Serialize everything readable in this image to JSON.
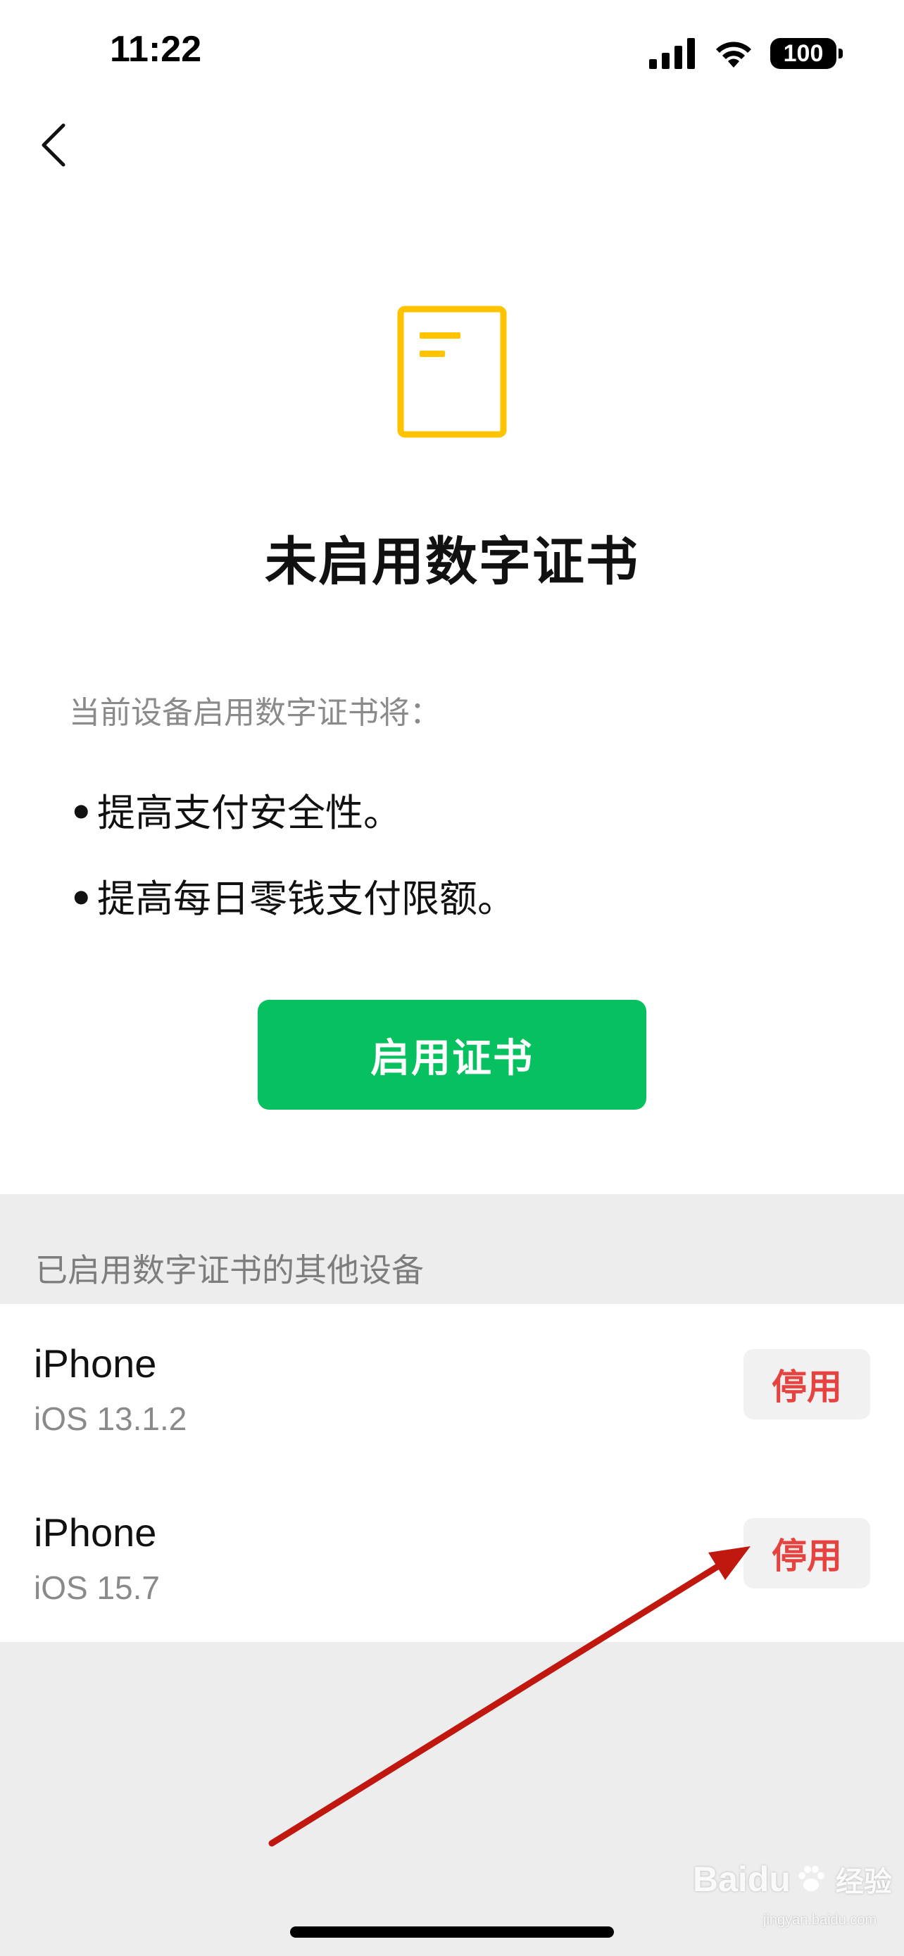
{
  "status_bar": {
    "time": "11:22",
    "battery_level": "100",
    "icons": [
      "signal-icon",
      "wifi-icon",
      "battery-icon"
    ]
  },
  "nav": {
    "back_icon": "chevron-left-icon"
  },
  "hero": {
    "icon": "document-icon",
    "icon_color": "#ffc300",
    "title": "未启用数字证书"
  },
  "intro": {
    "text": "当前设备启用数字证书将：",
    "benefits": [
      {
        "bullet": "•",
        "text": "提高支付安全性。"
      },
      {
        "bullet": "•",
        "text": "提高每日零钱支付限额。"
      }
    ]
  },
  "enable_button": {
    "label": "启用证书",
    "color": "#07c160"
  },
  "other_devices": {
    "header": "已启用数字证书的其他设备",
    "devices": [
      {
        "name": "iPhone",
        "os": "iOS 13.1.2",
        "action": "停用"
      },
      {
        "name": "iPhone",
        "os": "iOS 15.7",
        "action": "停用"
      }
    ],
    "action_color": "#e64340"
  },
  "annotation": {
    "arrow_color": "#c0170f",
    "arrow_points_to": "second-device-disable-button"
  },
  "watermark": {
    "brand": "Baidu",
    "cn": "经验",
    "url": "jingyan.baidu.com"
  }
}
